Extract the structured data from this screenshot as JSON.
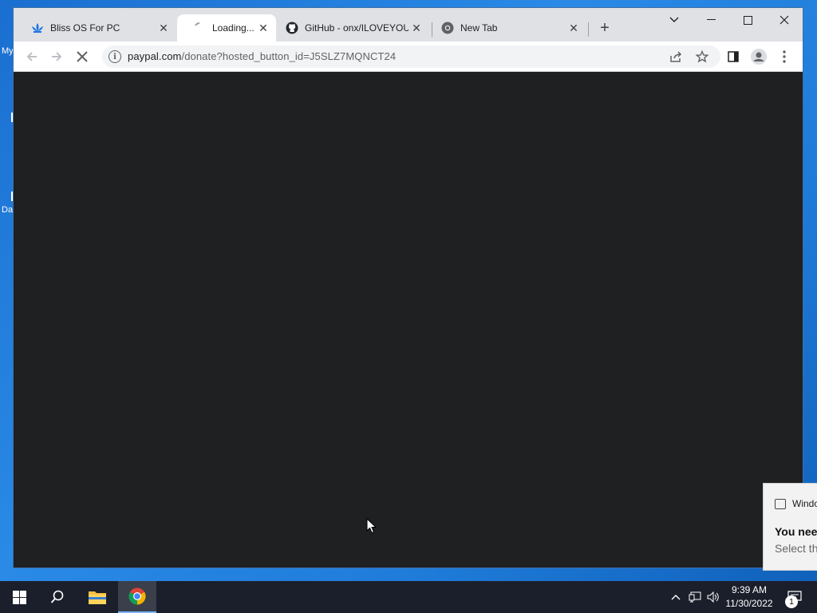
{
  "desktop": {
    "labels": [
      "My",
      "Da"
    ]
  },
  "browser": {
    "tabs": [
      {
        "title": "Bliss OS For PC",
        "icon": "bliss-lotus-icon"
      },
      {
        "title": "Loading...",
        "icon": "loading-spinner-icon",
        "active": true
      },
      {
        "title": "GitHub - onx/ILOVEYOU",
        "icon": "github-icon"
      },
      {
        "title": "New Tab",
        "icon": "chrome-icon"
      }
    ],
    "url_domain": "paypal.com",
    "url_path": "/donate?hosted_button_id=J5SLZ7MQNCT24"
  },
  "toast": {
    "app": "Windo",
    "title": "You nee",
    "body": "Select th"
  },
  "taskbar": {
    "time": "9:39 AM",
    "date": "11/30/2022",
    "notification_count": "1"
  },
  "colors": {
    "accent": "#1a73e8",
    "page_bg": "#1f2022",
    "taskbar": "#1b1f2b"
  }
}
